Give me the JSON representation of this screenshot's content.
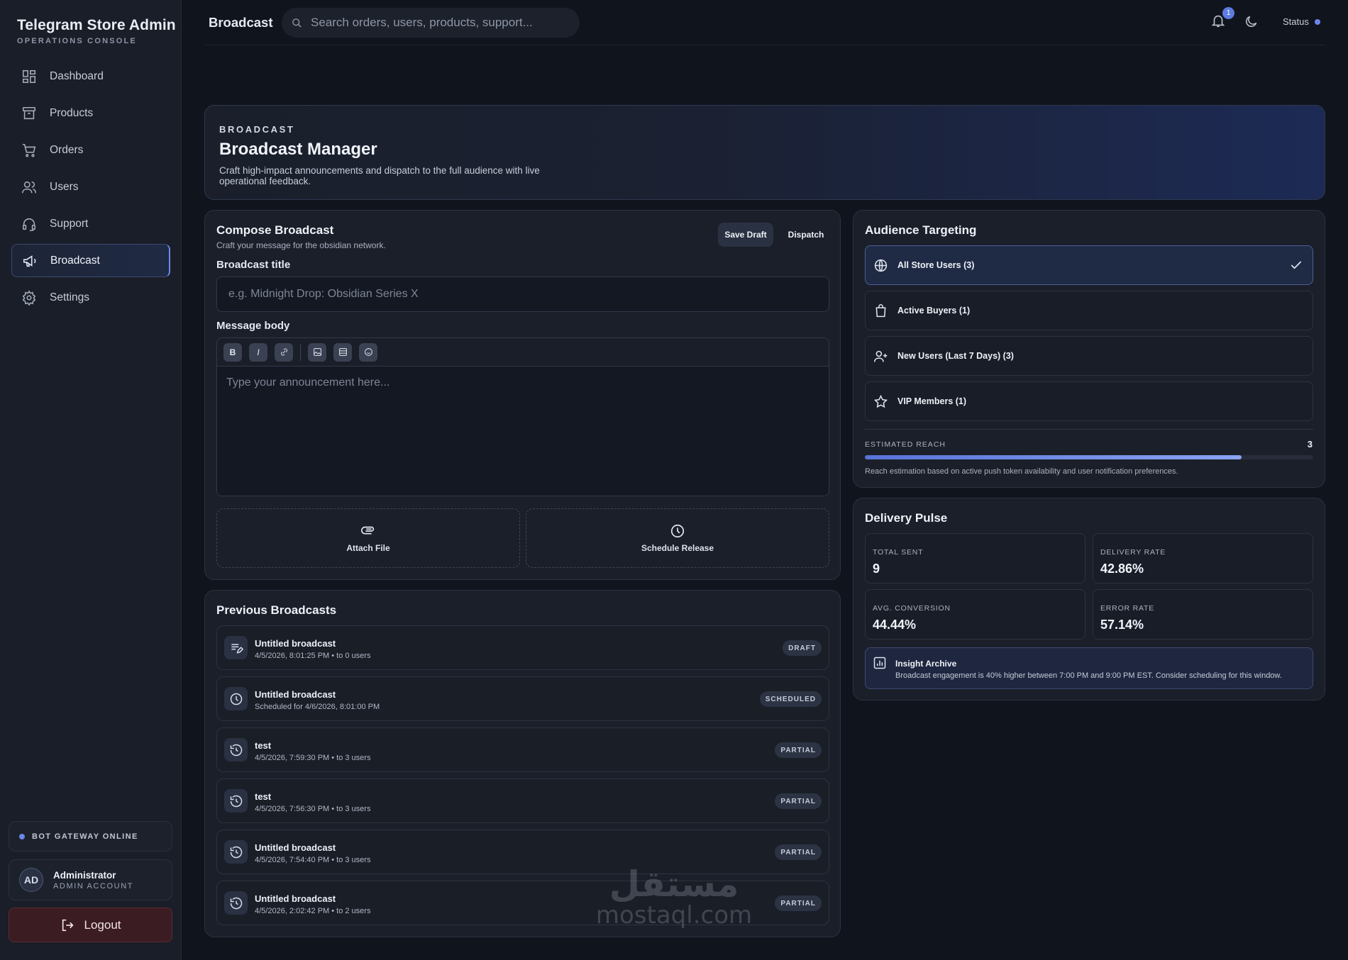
{
  "brand": {
    "title": "Telegram Store Admin",
    "subtitle": "OPERATIONS CONSOLE"
  },
  "sidebar": {
    "items": [
      {
        "label": "Dashboard",
        "icon": "dashboard-icon"
      },
      {
        "label": "Products",
        "icon": "archive-icon"
      },
      {
        "label": "Orders",
        "icon": "cart-icon"
      },
      {
        "label": "Users",
        "icon": "users-icon"
      },
      {
        "label": "Support",
        "icon": "headset-icon"
      },
      {
        "label": "Broadcast",
        "icon": "megaphone-icon",
        "active": true
      },
      {
        "label": "Settings",
        "icon": "gear-icon"
      }
    ],
    "gateway": "BOT GATEWAY ONLINE",
    "account": {
      "initials": "AD",
      "name": "Administrator",
      "role": "ADMIN ACCOUNT"
    },
    "logout": "Logout"
  },
  "topbar": {
    "crumb": "Broadcast",
    "search_placeholder": "Search orders, users, products, support...",
    "notifications": "1",
    "status": "Status"
  },
  "hero": {
    "kicker": "BROADCAST",
    "title": "Broadcast Manager",
    "description": "Craft high-impact announcements and dispatch to the full audience with live operational feedback."
  },
  "compose": {
    "title": "Compose Broadcast",
    "subtitle": "Craft your message for the obsidian network.",
    "save_draft": "Save Draft",
    "dispatch": "Dispatch",
    "title_label": "Broadcast title",
    "title_placeholder": "e.g. Midnight Drop: Obsidian Series X",
    "body_label": "Message body",
    "body_placeholder": "Type your announcement here...",
    "toolbar": {
      "bold": "B",
      "italic": "I"
    },
    "attach": "Attach File",
    "schedule": "Schedule Release"
  },
  "previous": {
    "title": "Previous Broadcasts",
    "items": [
      {
        "title": "Untitled broadcast",
        "meta": "4/5/2026, 8:01:25 PM • to 0 users",
        "status": "DRAFT",
        "icon": "draft-edit-icon"
      },
      {
        "title": "Untitled broadcast",
        "meta": "Scheduled for 4/6/2026, 8:01:00 PM",
        "status": "SCHEDULED",
        "icon": "clock-icon"
      },
      {
        "title": "test",
        "meta": "4/5/2026, 7:59:30 PM • to 3 users",
        "status": "PARTIAL",
        "icon": "history-icon"
      },
      {
        "title": "test",
        "meta": "4/5/2026, 7:56:30 PM • to 3 users",
        "status": "PARTIAL",
        "icon": "history-icon"
      },
      {
        "title": "Untitled broadcast",
        "meta": "4/5/2026, 7:54:40 PM • to 3 users",
        "status": "PARTIAL",
        "icon": "history-icon"
      },
      {
        "title": "Untitled broadcast",
        "meta": "4/5/2026, 2:02:42 PM • to 2 users",
        "status": "PARTIAL",
        "icon": "history-icon"
      }
    ]
  },
  "audience": {
    "title": "Audience Targeting",
    "options": [
      {
        "label": "All Store Users (3)",
        "icon": "globe-icon",
        "selected": true
      },
      {
        "label": "Active Buyers (1)",
        "icon": "shopping-bag-icon"
      },
      {
        "label": "New Users (Last 7 Days) (3)",
        "icon": "user-plus-icon"
      },
      {
        "label": "VIP Members (1)",
        "icon": "star-icon"
      }
    ],
    "reach_label": "ESTIMATED REACH",
    "reach_value": "3",
    "reach_fraction": 0.84,
    "reach_note": "Reach estimation based on active push token availability and user notification preferences."
  },
  "pulse": {
    "title": "Delivery Pulse",
    "metrics": [
      {
        "label": "TOTAL SENT",
        "value": "9"
      },
      {
        "label": "DELIVERY RATE",
        "value": "42.86%"
      },
      {
        "label": "AVG. CONVERSION",
        "value": "44.44%"
      },
      {
        "label": "ERROR RATE",
        "value": "57.14%"
      }
    ],
    "insight_title": "Insight Archive",
    "insight_body": "Broadcast engagement is 40% higher between 7:00 PM and 9:00 PM EST. Consider scheduling for this window."
  },
  "watermark": {
    "arabic": "مستقل",
    "latin": "mostaql.com"
  },
  "colors": {
    "accent": "#5d7be0",
    "background": "#10141d",
    "logout": "#3b1c22"
  }
}
